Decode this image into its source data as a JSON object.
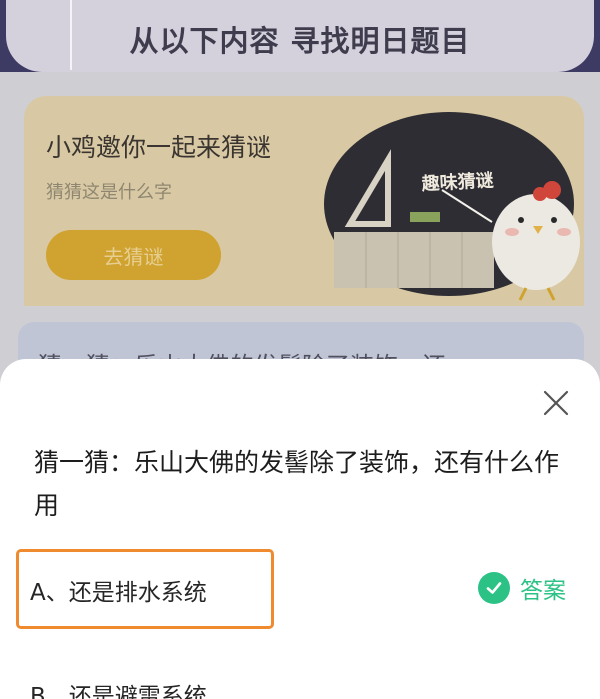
{
  "background": {
    "banner_title": "从以下内容 寻找明日题目",
    "riddle_card": {
      "title": "小鸡邀你一起来猜谜",
      "subtitle": "猜猜这是什么字",
      "button_label": "去猜谜",
      "illustration_caption": "趣味猜谜"
    },
    "next_card_peek": "猜一猜：乐山大佛的发髻除了装饰，还"
  },
  "sheet": {
    "question": "猜一猜：乐山大佛的发髻除了装饰，还有什么作用",
    "options": [
      {
        "label": "A、还是排水系统",
        "is_answer": true
      },
      {
        "label": "B、还是避雷系统",
        "is_answer": false
      }
    ],
    "answer_label": "答案"
  },
  "colors": {
    "accent_green": "#2cc286",
    "highlight_orange": "#ef8a2e",
    "button_gold": "#d0a22f"
  },
  "icons": {
    "close": "close-icon",
    "check": "check-circle-icon"
  }
}
